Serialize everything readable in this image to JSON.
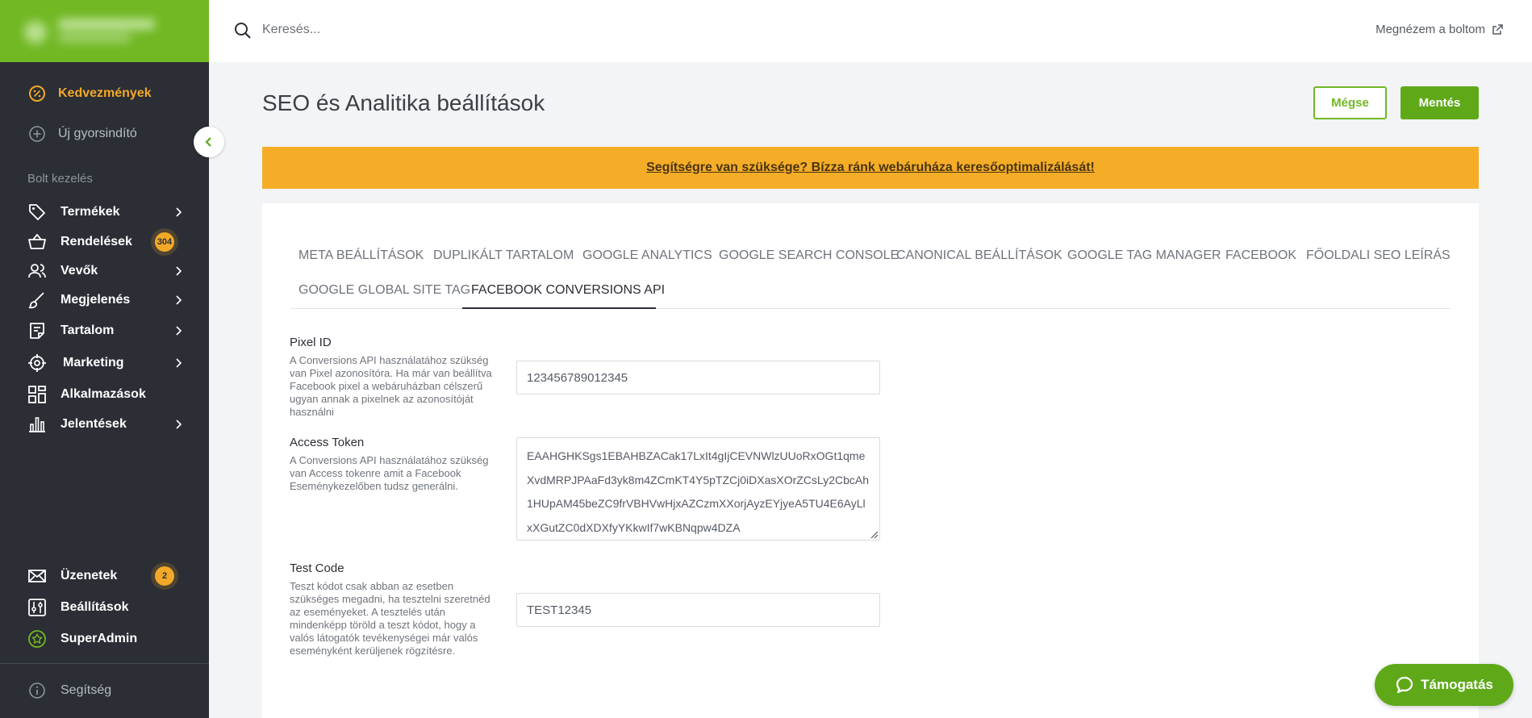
{
  "sidebar": {
    "top_items": [
      {
        "label": "Kedvezmények",
        "icon": "percent-icon"
      },
      {
        "label": "Új gyorsindító",
        "icon": "plus-circle-icon"
      }
    ],
    "section_label": "Bolt kezelés",
    "items": [
      {
        "label": "Termékek",
        "icon": "tag-icon"
      },
      {
        "label": "Rendelések",
        "icon": "basket-icon",
        "badge": "304"
      },
      {
        "label": "Vevők",
        "icon": "users-icon"
      },
      {
        "label": "Megjelenés",
        "icon": "brush-icon"
      },
      {
        "label": "Tartalom",
        "icon": "document-icon"
      },
      {
        "label": "Marketing",
        "icon": "target-icon"
      },
      {
        "label": "Alkalmazások",
        "icon": "apps-grid-icon"
      },
      {
        "label": "Jelentések",
        "icon": "bar-chart-icon"
      }
    ],
    "bottom_items": [
      {
        "label": "Üzenetek",
        "icon": "envelope-icon",
        "badge": "2"
      },
      {
        "label": "Beállítások",
        "icon": "settings-icon"
      },
      {
        "label": "SuperAdmin",
        "icon": "star-circle-icon"
      }
    ],
    "help": {
      "label": "Segítség",
      "icon": "info-icon"
    }
  },
  "topbar": {
    "search_placeholder": "Keresés...",
    "store_link": "Megnézem a boltom"
  },
  "page": {
    "title": "SEO és Analitika beállítások",
    "cancel_label": "Mégse",
    "save_label": "Mentés",
    "banner_text": "Segítségre van szüksége? Bízza ránk webáruháza keresőoptimalizálását!"
  },
  "tabs": [
    "META BEÁLLÍTÁSOK",
    "DUPLIKÁLT TARTALOM",
    "GOOGLE ANALYTICS",
    "GOOGLE SEARCH CONSOLE",
    "CANONICAL BEÁLLÍTÁSOK",
    "GOOGLE TAG MANAGER",
    "FACEBOOK",
    "FŐOLDALI SEO LEÍRÁS",
    "GOOGLE GLOBAL SITE TAG",
    "FACEBOOK CONVERSIONS API"
  ],
  "active_tab": "FACEBOOK CONVERSIONS API",
  "form": {
    "pixel_id": {
      "label": "Pixel ID",
      "help": "A Conversions API használatához szükség van Pixel azonosítóra. Ha már van beállítva Facebook pixel a webáruházban célszerű ugyan annak a pixelnek az azonosítóját használni",
      "value": "123456789012345"
    },
    "access_token": {
      "label": "Access Token",
      "help": "A Conversions API használatához szükség van Access tokenre amit a Facebook Eseménykezelőben tudsz generálni.",
      "value": "EAAHGHKSgs1EBAHBZACak17LxIt4gIjCEVNWlzUUoRxOGt1qmeXvdMRPJPAaFd3yk8m4ZCmKT4Y5pTZCj0iDXasXOrZCsLy2CbcAh1HUpAM45beZC9frVBHVwHjxAZCzmXXorjAyzEYjyeA5TU4E6AyLlxXGutZC0dXDXfyYKkwIf7wKBNqpw4DZA"
    },
    "test_code": {
      "label": "Test Code",
      "help": "Teszt kódot csak abban az esetben szükséges megadni, ha tesztelni szeretnéd az eseményeket. A tesztelés után mindenképp töröld a teszt kódot, hogy a valós látogatók tevékenységei már valós eseményként kerüljenek rögzítésre.",
      "value": "TEST12345"
    }
  },
  "support_label": "Támogatás",
  "colors": {
    "brand_green": "#71b824",
    "sidebar_bg": "#2b2e35",
    "accent_orange": "#f3a827",
    "banner_orange": "#f5ad28"
  }
}
